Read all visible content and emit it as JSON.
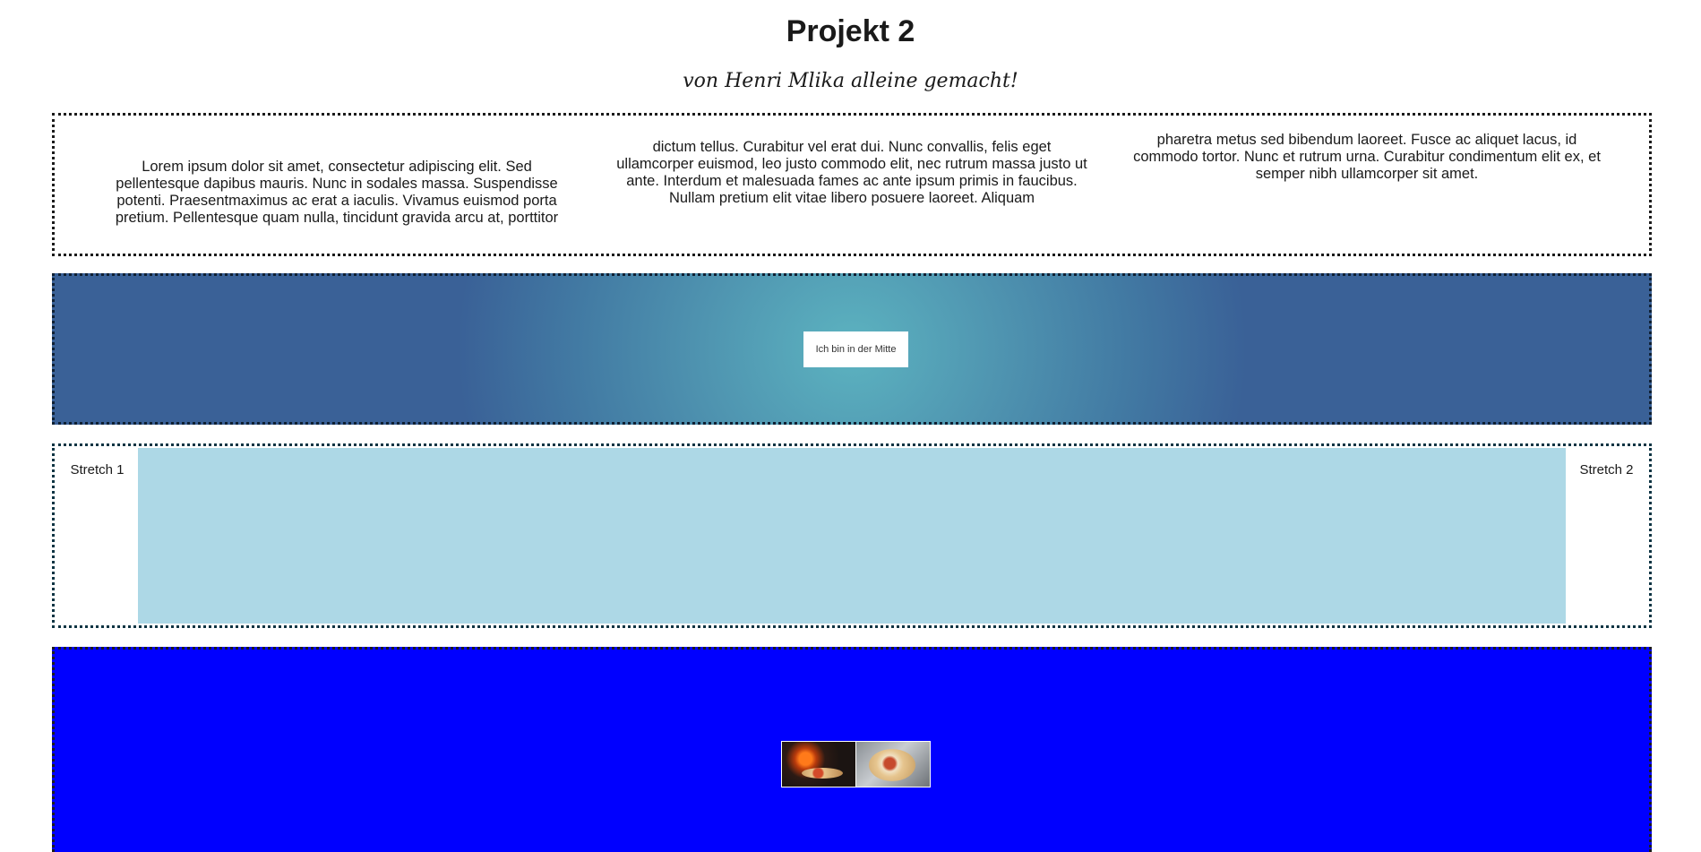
{
  "header": {
    "title": "Projekt 2",
    "subtitle": "von Henri Mlika alleine gemacht!"
  },
  "columns": [
    "Lorem ipsum dolor sit amet, consectetur adipiscing elit. Sed pellentesque dapibus mauris. Nunc in sodales massa. Suspendisse potenti. Praesentmaximus ac erat a iaculis. Vivamus euismod porta pretium. Pellentesque quam nulla, tincidunt gravida arcu at, porttitor",
    "dictum tellus. Curabitur vel erat dui. Nunc convallis, felis eget ullamcorper euismod, leo justo commodo elit, nec rutrum massa justo ut ante. Interdum et malesuada fames ac ante ipsum primis in faucibus. Nullam pretium elit vitae libero posuere laoreet. Aliquam",
    "pharetra metus sed bibendum laoreet. Fusce ac aliquet lacus, id commodo tortor. Nunc et rutrum urna. Curabitur condimentum elit ex, et semper nibh ullamcorper sit amet."
  ],
  "center": {
    "label": "Ich bin in der Mitte"
  },
  "stretch": {
    "item1": "Stretch 1",
    "item2": "Stretch 2"
  },
  "images": [
    {
      "icon": "pizza-oven-image"
    },
    {
      "icon": "pizza-plate-image"
    }
  ],
  "colors": {
    "gradient_center": "#5cb3c0",
    "gradient_edge": "#3a6197",
    "stretch_fill": "#add8e6",
    "blue_section": "#0000ff"
  }
}
